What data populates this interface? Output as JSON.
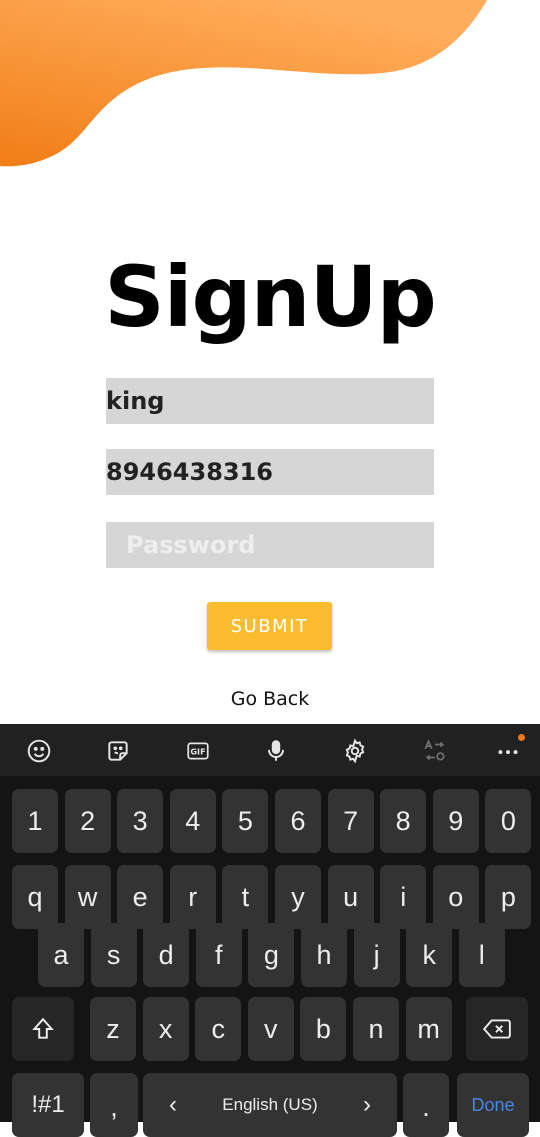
{
  "signup": {
    "title": "SignUp",
    "username_value": "king",
    "phone_value": "8946438316",
    "password_placeholder": "Password",
    "submit_label": "SUBMIT",
    "go_back_label": "Go Back"
  },
  "colors": {
    "blob_light": "#FFAA55",
    "blob_dark": "#F5841A",
    "field_bg": "#D6D6D6",
    "submit_bg": "#FBBD2F",
    "keyboard_bg": "#141414",
    "key_bg": "#333333",
    "done_color": "#4A86E8"
  },
  "keyboard": {
    "toolbar_icons": [
      "emoji-icon",
      "sticker-icon",
      "gif-icon",
      "microphone-icon",
      "settings-icon",
      "translate-icon",
      "more-icon"
    ],
    "gif_label": "GIF",
    "row_numbers": [
      "1",
      "2",
      "3",
      "4",
      "5",
      "6",
      "7",
      "8",
      "9",
      "0"
    ],
    "row_top": [
      "q",
      "w",
      "e",
      "r",
      "t",
      "y",
      "u",
      "i",
      "o",
      "p"
    ],
    "row_middle": [
      "a",
      "s",
      "d",
      "f",
      "g",
      "h",
      "j",
      "k",
      "l"
    ],
    "row_bottom": [
      "z",
      "x",
      "c",
      "v",
      "b",
      "n",
      "m"
    ],
    "symbols_label": "!#1",
    "comma_label": ",",
    "period_label": ".",
    "space_label": "English (US)",
    "space_left_arrow": "‹",
    "space_right_arrow": "›",
    "done_label": "Done"
  }
}
